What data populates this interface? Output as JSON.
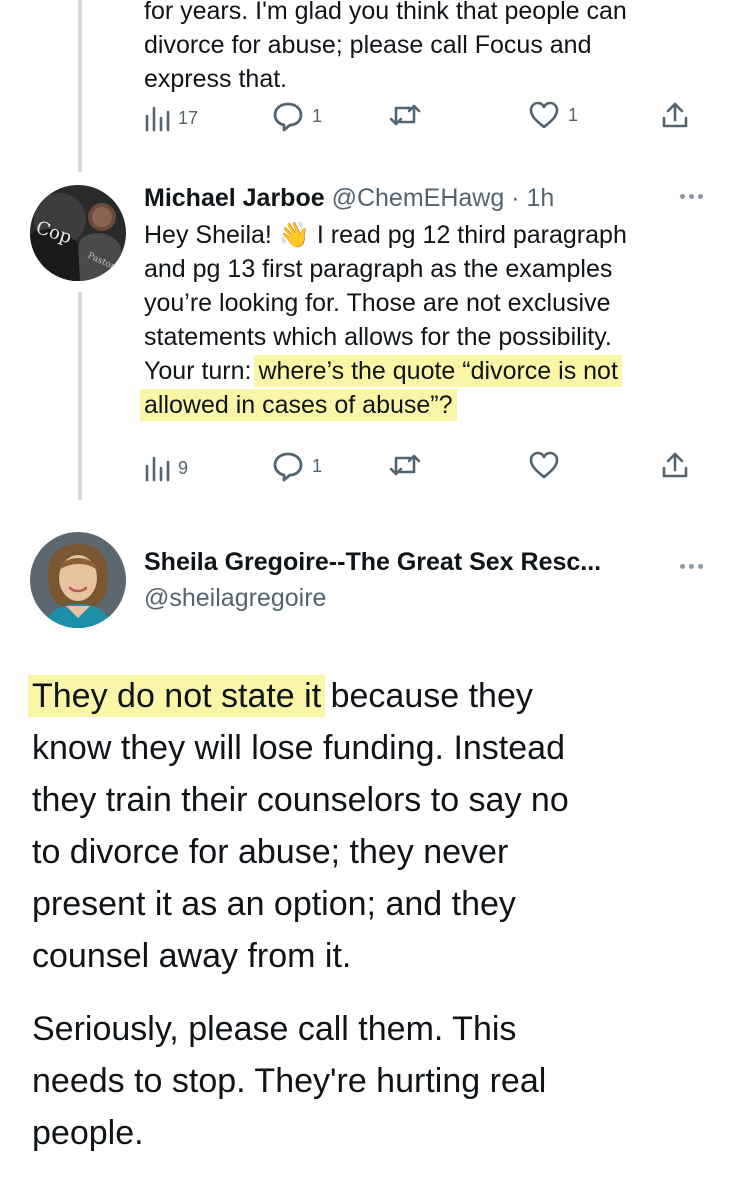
{
  "tweet1": {
    "text_lines": [
      "for years. I'm glad you think that people can",
      "divorce for abuse; please call Focus and",
      "express that."
    ],
    "views": "17",
    "replies": "1",
    "likes": "1"
  },
  "tweet2": {
    "author_name": "Michael Jarboe",
    "handle": "@ChemEHawg",
    "time": "· 1h",
    "line1_a": "Hey Sheila!",
    "line1_emoji": "👋",
    "line1_b": "I read pg 12 third paragraph",
    "line2": "and pg 13 first paragraph as the examples",
    "line3": "you’re looking for. Those are not exclusive",
    "line4": "statements which allows for the possibility.",
    "line5_a": "Your turn:",
    "line5_hl": "where’s the quote “divorce is not",
    "line6_hl": "allowed in cases of abuse”?",
    "views": "9",
    "replies": "1",
    "avatar_text": "Cop"
  },
  "tweet3": {
    "author_name": "Sheila Gregoire--The Great Sex Resc...",
    "handle": "@sheilagregoire",
    "line1_hl": "They do not state it",
    "line1_rest": " because they",
    "lines": [
      "know they will lose funding. Instead",
      "they train their counselors to say no",
      "to divorce for abuse; they never",
      "present it as an option; and they",
      "counsel away from it."
    ],
    "para2": [
      "Seriously, please call them. This",
      "needs to stop. They're hurting real",
      "people."
    ]
  },
  "icons": {
    "views": "bar-chart-icon",
    "reply": "speech-bubble-icon",
    "retweet": "retweet-icon",
    "like": "heart-icon",
    "share": "share-icon",
    "more": "more-dots-icon"
  },
  "colors": {
    "highlight": "#fbf5a8",
    "secondary_text": "#536471",
    "thread_line": "#cfd9de"
  }
}
